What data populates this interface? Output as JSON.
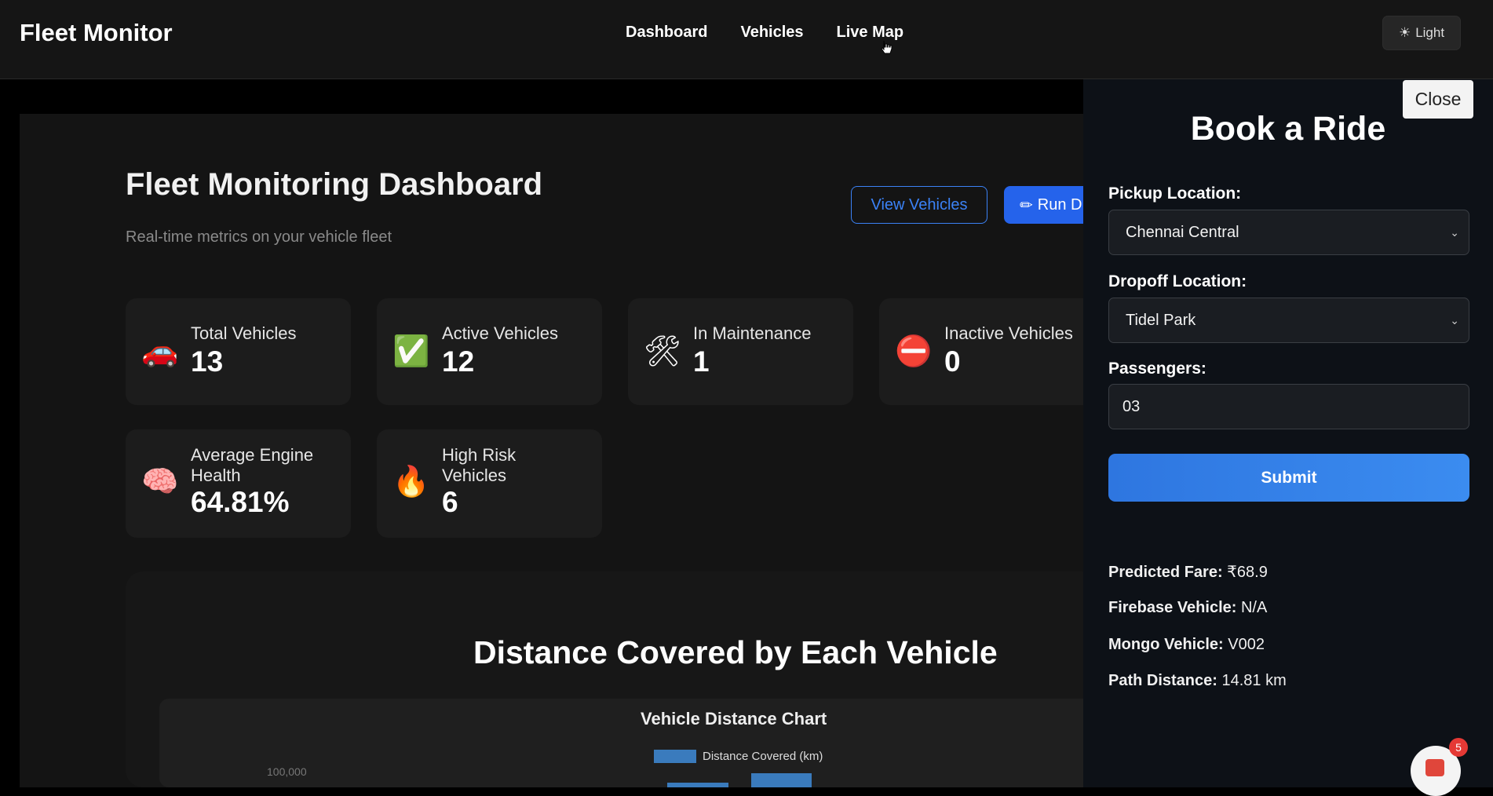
{
  "nav": {
    "brand": "Fleet Monitor",
    "links": [
      "Dashboard",
      "Vehicles",
      "Live Map"
    ],
    "theme_icon": "sun-icon",
    "theme_label": "Light"
  },
  "dashboard": {
    "title": "Fleet Monitoring Dashboard",
    "subtitle": "Real-time metrics on your vehicle fleet",
    "view_button": "View Vehicles",
    "run_button": "Run D",
    "run_icon": "pencil-icon",
    "cards": [
      {
        "icon": "car-icon",
        "glyph": "🚗",
        "label": "Total Vehicles",
        "value": "13"
      },
      {
        "icon": "check-icon",
        "glyph": "✅",
        "label": "Active Vehicles",
        "value": "12"
      },
      {
        "icon": "tools-icon",
        "glyph": "🛠",
        "label": "In Maintenance",
        "value": "1"
      },
      {
        "icon": "no-entry-icon",
        "glyph": "⛔",
        "label": "Inactive Vehicles",
        "value": "0"
      },
      {
        "icon": "brain-icon",
        "glyph": "🧠",
        "label": "Average Engine Health",
        "value": "64.81%"
      },
      {
        "icon": "fire-icon",
        "glyph": "🔥",
        "label": "High Risk Vehicles",
        "value": "6"
      }
    ]
  },
  "chart_section": {
    "heading": "Distance Covered by Each Vehicle"
  },
  "chart_data": {
    "type": "bar",
    "title": "Vehicle Distance Chart",
    "legend": [
      "Distance Covered (km)"
    ],
    "visible_ticks": [
      "100,000"
    ],
    "series": [
      {
        "name": "Distance Covered (km)",
        "color": "#3a7bbd"
      }
    ]
  },
  "booking": {
    "close_label": "Close",
    "title": "Book a Ride",
    "pickup_label": "Pickup Location:",
    "pickup_value": "Chennai Central",
    "dropoff_label": "Dropoff Location:",
    "dropoff_value": "Tidel Park",
    "passengers_label": "Passengers:",
    "passengers_value": "03",
    "submit_label": "Submit",
    "results": [
      {
        "label": "Predicted Fare:",
        "value": "₹68.9"
      },
      {
        "label": "Firebase Vehicle:",
        "value": "N/A"
      },
      {
        "label": "Mongo Vehicle:",
        "value": "V002"
      },
      {
        "label": "Path Distance:",
        "value": "14.81 km"
      }
    ]
  },
  "notifications": {
    "badge": "5"
  }
}
